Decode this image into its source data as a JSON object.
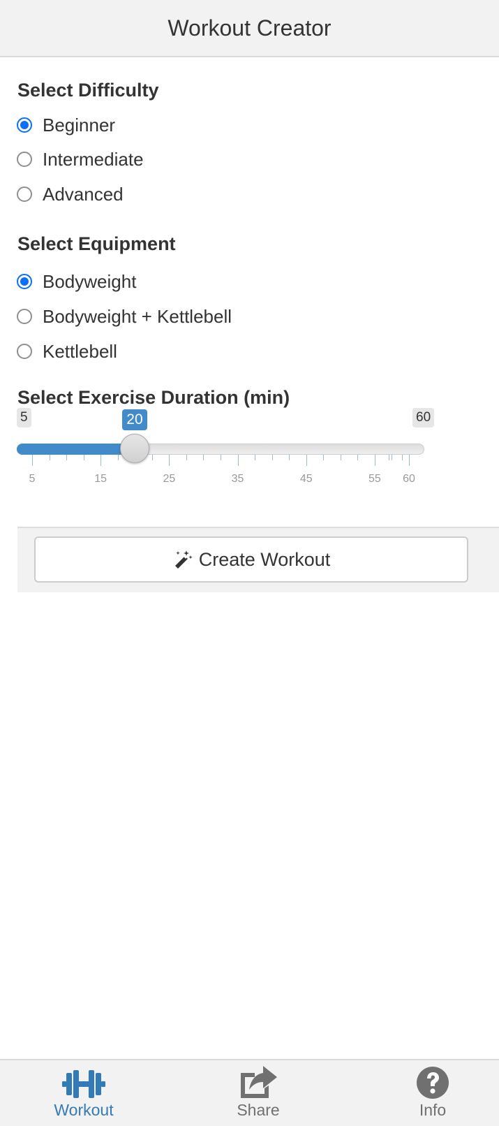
{
  "header": {
    "title": "Workout Creator"
  },
  "difficulty": {
    "title": "Select Difficulty",
    "options": [
      {
        "label": "Beginner",
        "checked": true
      },
      {
        "label": "Intermediate",
        "checked": false
      },
      {
        "label": "Advanced",
        "checked": false
      }
    ]
  },
  "equipment": {
    "title": "Select Equipment",
    "options": [
      {
        "label": "Bodyweight",
        "checked": true
      },
      {
        "label": "Bodyweight + Kettlebell",
        "checked": false
      },
      {
        "label": "Kettlebell",
        "checked": false
      }
    ]
  },
  "duration": {
    "title": "Select Exercise Duration (min)",
    "min": 5,
    "max": 60,
    "value": 20,
    "min_label": "5",
    "max_label": "60",
    "value_label": "20",
    "tick_labels": [
      "5",
      "15",
      "25",
      "35",
      "45",
      "55",
      "60"
    ],
    "accent_color": "#428bca"
  },
  "create_button": {
    "label": "Create Workout",
    "icon": "magic-wand-icon"
  },
  "bottom_nav": {
    "items": [
      {
        "label": "Workout",
        "icon": "dumbbell-icon",
        "active": true,
        "color": "#337ab7"
      },
      {
        "label": "Share",
        "icon": "share-icon",
        "active": false,
        "color": "#707070"
      },
      {
        "label": "Info",
        "icon": "question-circle-icon",
        "active": false,
        "color": "#707070"
      }
    ]
  }
}
